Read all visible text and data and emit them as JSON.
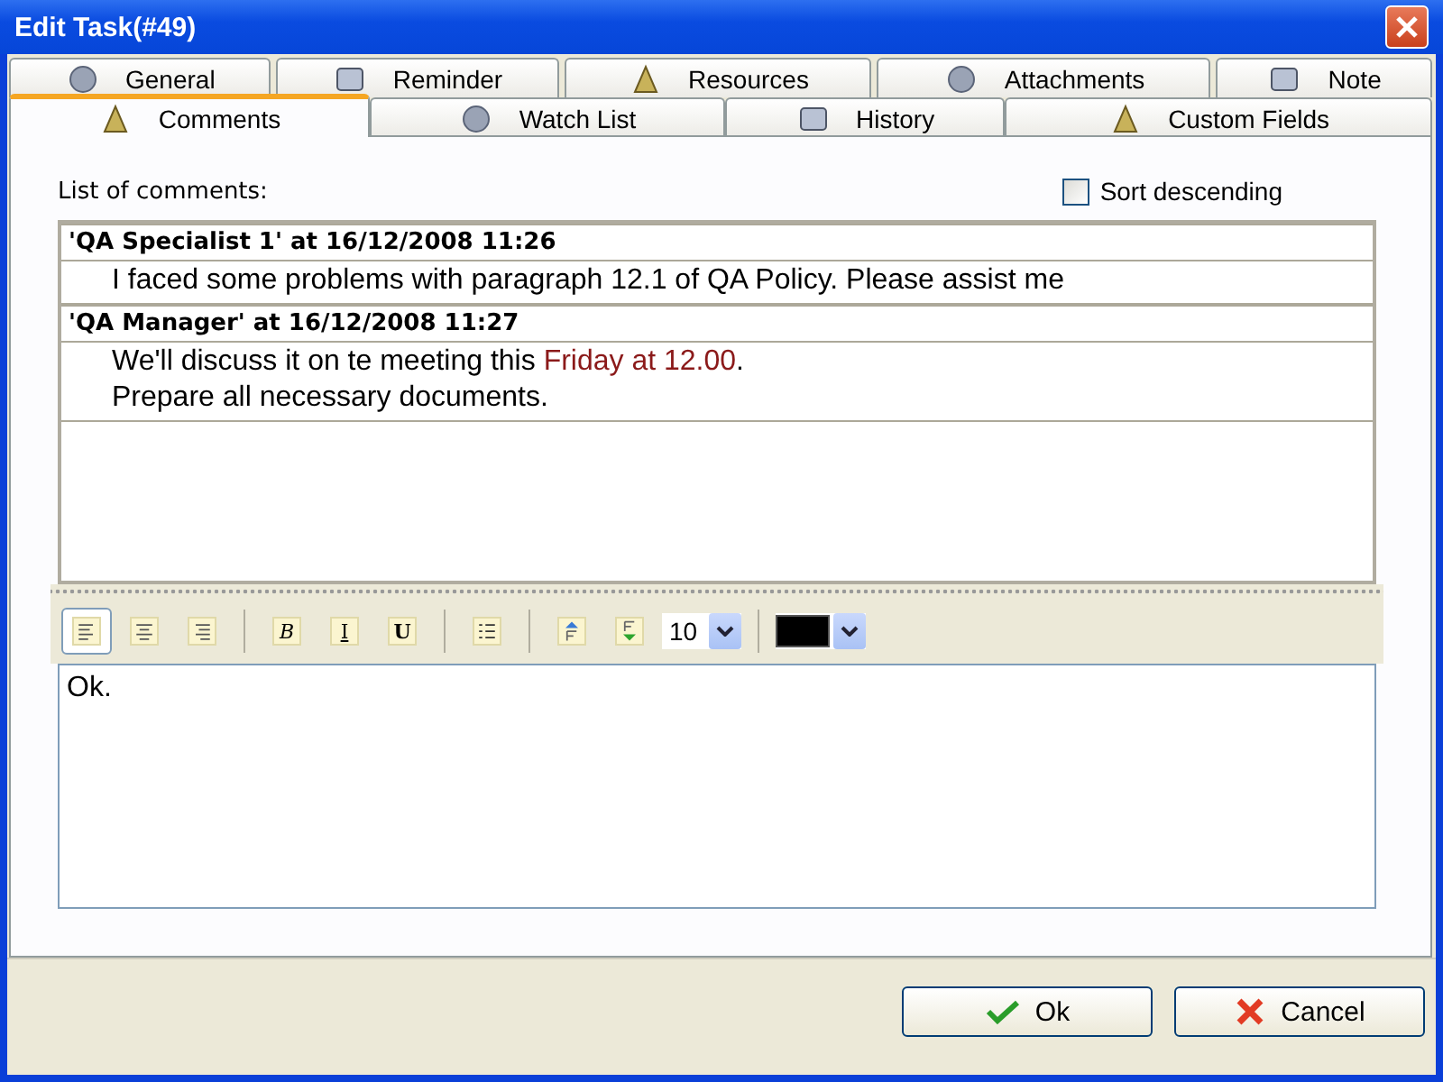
{
  "window": {
    "title": "Edit Task(#49)"
  },
  "tab_rows": [
    {
      "tabs": [
        {
          "label": "General",
          "selected": false
        },
        {
          "label": "Reminder",
          "selected": false
        },
        {
          "label": "Resources",
          "selected": false
        },
        {
          "label": "Attachments",
          "selected": false
        },
        {
          "label": "Note",
          "selected": false
        }
      ]
    },
    {
      "tabs": [
        {
          "label": "Comments",
          "selected": true
        },
        {
          "label": "Watch List",
          "selected": false
        },
        {
          "label": "History",
          "selected": false
        },
        {
          "label": "Custom Fields",
          "selected": false
        }
      ]
    }
  ],
  "comments_label": "List of comments:",
  "sort_descending": {
    "label": "Sort descending",
    "checked": false
  },
  "comments": [
    {
      "header": "'QA Specialist 1' at 16/12/2008 11:26",
      "lines": [
        [
          {
            "text": "I faced some problems with paragraph 12.1 of QA Policy. Please assist me",
            "highlight": false
          }
        ]
      ]
    },
    {
      "header": "'QA Manager' at 16/12/2008 11:27",
      "lines": [
        [
          {
            "text": "We'll discuss it on te meeting this ",
            "highlight": false
          },
          {
            "text": "Friday at 12.00",
            "highlight": true
          },
          {
            "text": ".",
            "highlight": false
          }
        ],
        [
          {
            "text": "Prepare all necessary documents.",
            "highlight": false
          }
        ]
      ]
    }
  ],
  "toolbar": [
    {
      "kind": "align-left",
      "selected": true
    },
    {
      "kind": "align-center",
      "selected": false
    },
    {
      "kind": "align-right",
      "selected": false
    },
    {
      "kind": "separator"
    },
    {
      "kind": "letter",
      "label": "B",
      "selected": false
    },
    {
      "kind": "letter",
      "label": "I",
      "selected": false
    },
    {
      "kind": "letter",
      "label": "U",
      "selected": false
    },
    {
      "kind": "separator"
    },
    {
      "kind": "bullets",
      "selected": false
    },
    {
      "kind": "separator"
    },
    {
      "kind": "move-up",
      "selected": false
    },
    {
      "kind": "move-down",
      "selected": false
    },
    {
      "kind": "font-size",
      "value": "10"
    },
    {
      "kind": "separator"
    },
    {
      "kind": "color",
      "color": "#000000"
    }
  ],
  "editor": {
    "value": "Ok."
  },
  "buttons": [
    {
      "label": "Ok",
      "kind": "ok"
    },
    {
      "label": "Cancel",
      "kind": "cancel"
    }
  ]
}
